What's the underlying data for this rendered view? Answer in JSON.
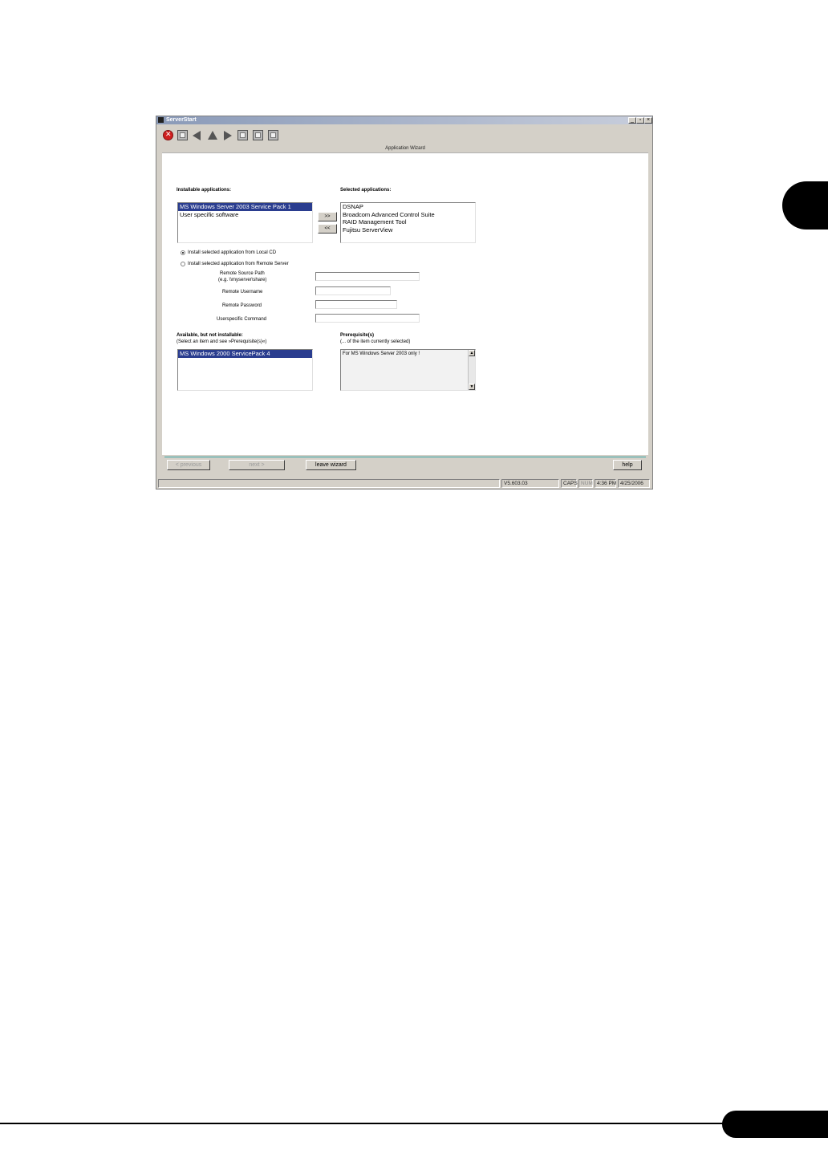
{
  "window": {
    "title": "ServerStart",
    "minimize": "_",
    "maximize": "▫",
    "close": "×"
  },
  "toolbar": {
    "icons": [
      "exit-icon",
      "home-icon",
      "back-icon",
      "up-icon",
      "forward-icon",
      "list-icon",
      "view-icon",
      "grid-icon"
    ]
  },
  "wizard": {
    "header": "Application Wizard",
    "installable_label": "Installable applications:",
    "installable_items": [
      "MS Windows Server 2003 Service Pack 1",
      "User specific software"
    ],
    "selected_label": "Selected applications:",
    "selected_items": [
      "DSNAP",
      "Broadcom Advanced Control Suite",
      "RAID Management Tool",
      "Fujitsu ServerView"
    ],
    "add_button": ">>",
    "remove_button": "<<",
    "radio_local": "Install selected application from Local CD",
    "radio_remote": "Install selected application from Remote Server",
    "remote_source_label": "Remote Source Path",
    "remote_source_hint": "(e.g. \\\\myserver\\share)",
    "remote_username_label": "Remote Username",
    "remote_password_label": "Remote Password",
    "userspecific_label": "Userspecific Command",
    "available_label": "Available, but not installable:",
    "available_hint": "(Select an item and see »Prerequisite(s)«)",
    "available_items": [
      "MS Windows 2000 ServicePack 4"
    ],
    "prereq_label": "Prerequisite(s)",
    "prereq_hint": "(... of the item currently selected)",
    "prereq_text": "For MS Windows Server 2003 only !"
  },
  "nav": {
    "previous": "< previous",
    "next": "next >",
    "leave": "leave wizard",
    "help": "help"
  },
  "status": {
    "version": "V5.603.03",
    "caps": "CAPS",
    "num": "NUM",
    "time": "4:36 PM",
    "date": "4/25/2006"
  }
}
